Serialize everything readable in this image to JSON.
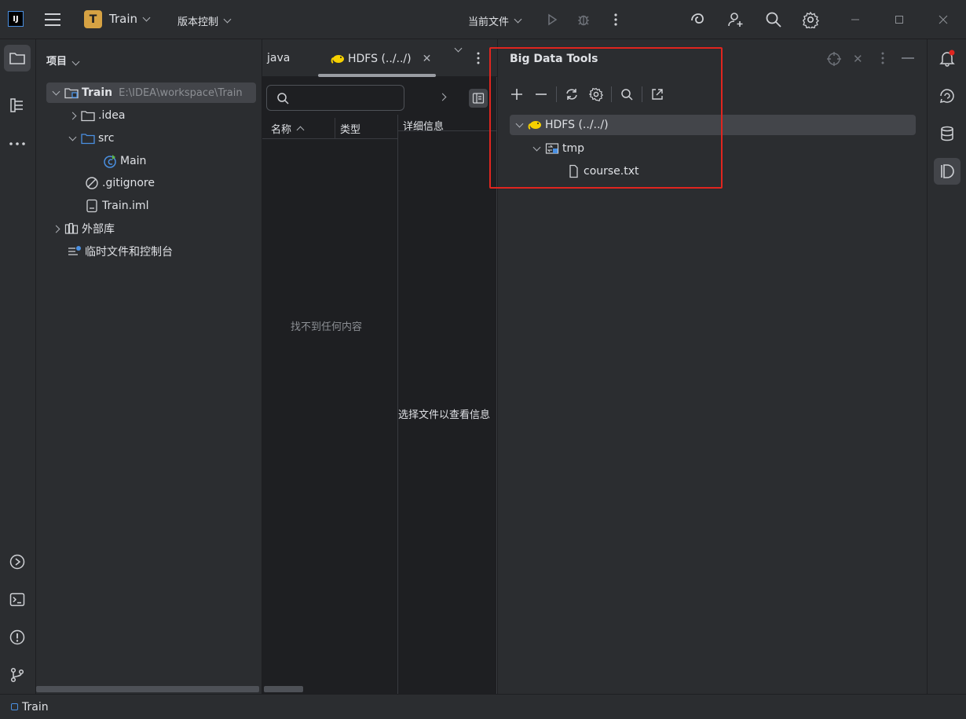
{
  "titlebar": {
    "app_logo": "IJ",
    "project_badge": "T",
    "project_name": "Train",
    "vcs_label": "版本控制",
    "run_config": "当前文件"
  },
  "project_panel": {
    "title": "项目",
    "tree": [
      {
        "label": "Train",
        "path": "E:\\IDEA\\workspace\\Train"
      },
      {
        "label": ".idea"
      },
      {
        "label": "src"
      },
      {
        "label": "Main"
      },
      {
        "label": ".gitignore"
      },
      {
        "label": "Train.iml"
      },
      {
        "label": "外部库"
      },
      {
        "label": "临时文件和控制台"
      }
    ]
  },
  "editor": {
    "tabs": [
      {
        "label": "java"
      },
      {
        "label": "HDFS (../../)"
      }
    ],
    "search_placeholder": "",
    "columns": [
      "名称",
      "类型",
      "详细信息"
    ],
    "empty_message": "找不到任何内容",
    "detail_message": "选择文件以查看信息"
  },
  "big_data_tools": {
    "title": "Big Data Tools",
    "tree": [
      {
        "label": "HDFS (../../)"
      },
      {
        "label": "tmp"
      },
      {
        "label": "course.txt"
      }
    ]
  },
  "statusbar": {
    "project": "Train"
  },
  "colors": {
    "highlight_box": "#e0251f",
    "project_badge": "#d6a243",
    "hdfs_elephant": "#f5d000"
  }
}
